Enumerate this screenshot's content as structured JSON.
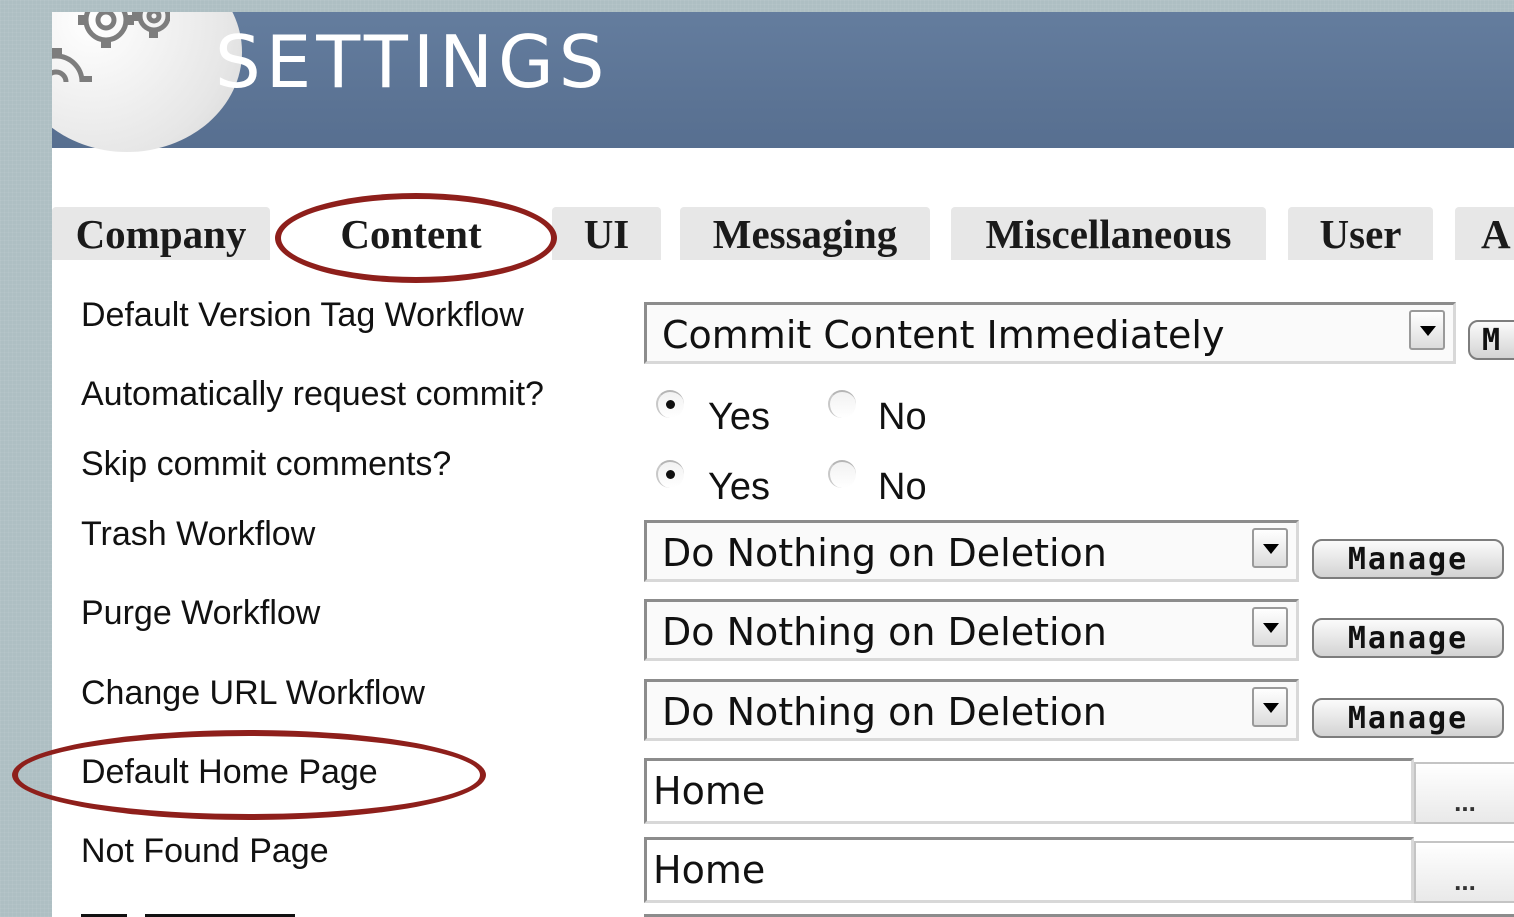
{
  "header": {
    "title": "SETTINGS"
  },
  "tabs": [
    {
      "label": "Company",
      "active": false
    },
    {
      "label": "Content",
      "active": true
    },
    {
      "label": "UI",
      "active": false
    },
    {
      "label": "Messaging",
      "active": false
    },
    {
      "label": "Miscellaneous",
      "active": false
    },
    {
      "label": "User",
      "active": false
    },
    {
      "label": "A",
      "active": false
    }
  ],
  "settings": {
    "default_version_tag_workflow": {
      "label": "Default Version Tag Workflow",
      "value": "Commit Content Immediately",
      "button": "M"
    },
    "auto_request_commit": {
      "label": "Automatically request commit?",
      "yes": "Yes",
      "no": "No",
      "selected": "Yes"
    },
    "skip_commit_comments": {
      "label": "Skip commit comments?",
      "yes": "Yes",
      "no": "No",
      "selected": "Yes"
    },
    "trash_workflow": {
      "label": "Trash Workflow",
      "value": "Do Nothing on Deletion",
      "button": "Manage"
    },
    "purge_workflow": {
      "label": "Purge Workflow",
      "value": "Do Nothing on Deletion",
      "button": "Manage"
    },
    "change_url_workflow": {
      "label": "Change URL Workflow",
      "value": "Do Nothing on Deletion",
      "button": "Manage"
    },
    "default_home_page": {
      "label": "Default Home Page",
      "value": "Home",
      "button": "..."
    },
    "not_found_page": {
      "label": "Not Found Page",
      "value": "Home",
      "button": "..."
    }
  },
  "annotation_color": "#8e1f1b"
}
